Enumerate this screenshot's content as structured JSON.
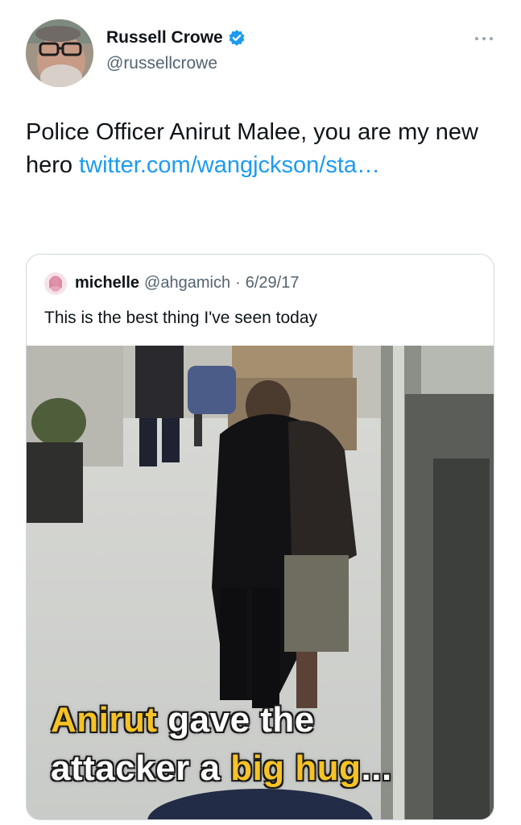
{
  "tweet": {
    "author_name": "Russell Crowe",
    "author_handle": "@russellcrowe",
    "text_main": "Police Officer Anirut Malee, you are my new hero ",
    "link_text": "twitter.com/wangjckson/sta…"
  },
  "quoted_tweet": {
    "author_name": "michelle",
    "author_handle": "@ahgamich",
    "separator": "·",
    "date": "6/29/17",
    "text": "This is the best thing I've seen today",
    "media": {
      "caption_line1_highlight": "Anirut",
      "caption_line1_rest": " gave the",
      "caption_line2_start": "attacker a ",
      "caption_line2_highlight": "big hug",
      "caption_line2_end": "..."
    }
  },
  "colors": {
    "link": "#1d9bf0",
    "verified_badge": "#1d9bf0",
    "secondary_text": "#536471",
    "caption_highlight": "#f6c225"
  },
  "icons": {
    "verified": "verified-badge-icon",
    "more": "more-options-icon"
  }
}
